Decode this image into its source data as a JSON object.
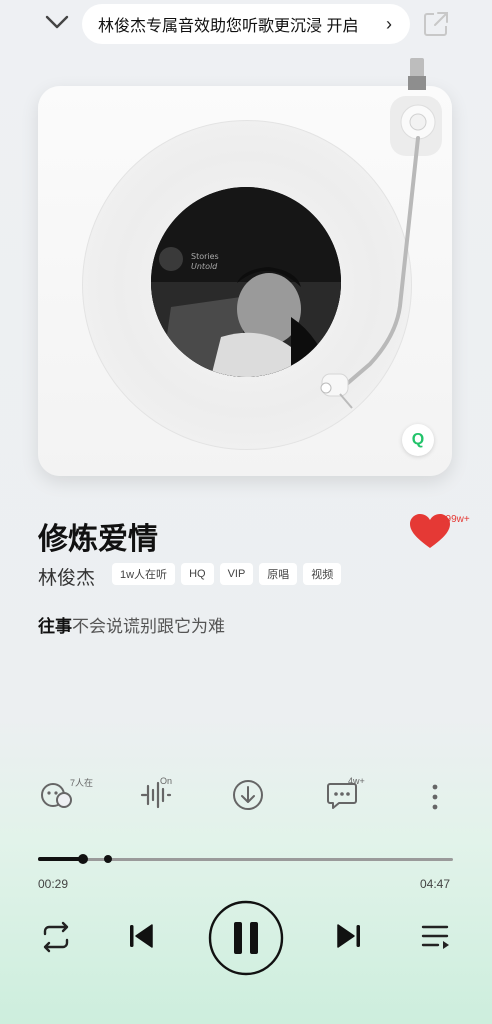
{
  "header": {
    "promo_text": "林俊杰专属音效助您听歌更沉浸 开启",
    "promo_arrow": "›"
  },
  "album": {
    "cover_text_line1": "Stories",
    "cover_text_line2": "Untold",
    "badge": "Q"
  },
  "song": {
    "title": "修炼爱情",
    "artist": "林俊杰",
    "like_count": "999w+",
    "tags": [
      "1w人在听",
      "HQ",
      "VIP",
      "原唱",
      "视频"
    ]
  },
  "lyric": {
    "sung": "往事",
    "rest": "不会说谎别跟它为难"
  },
  "actions": {
    "listeners": "7人在",
    "effect": "On",
    "comments": "4w+"
  },
  "progress": {
    "current": "00:29",
    "total": "04:47",
    "fraction": 0.101
  },
  "colors": {
    "accent_green": "#22c36a",
    "like_red": "#e53935"
  }
}
